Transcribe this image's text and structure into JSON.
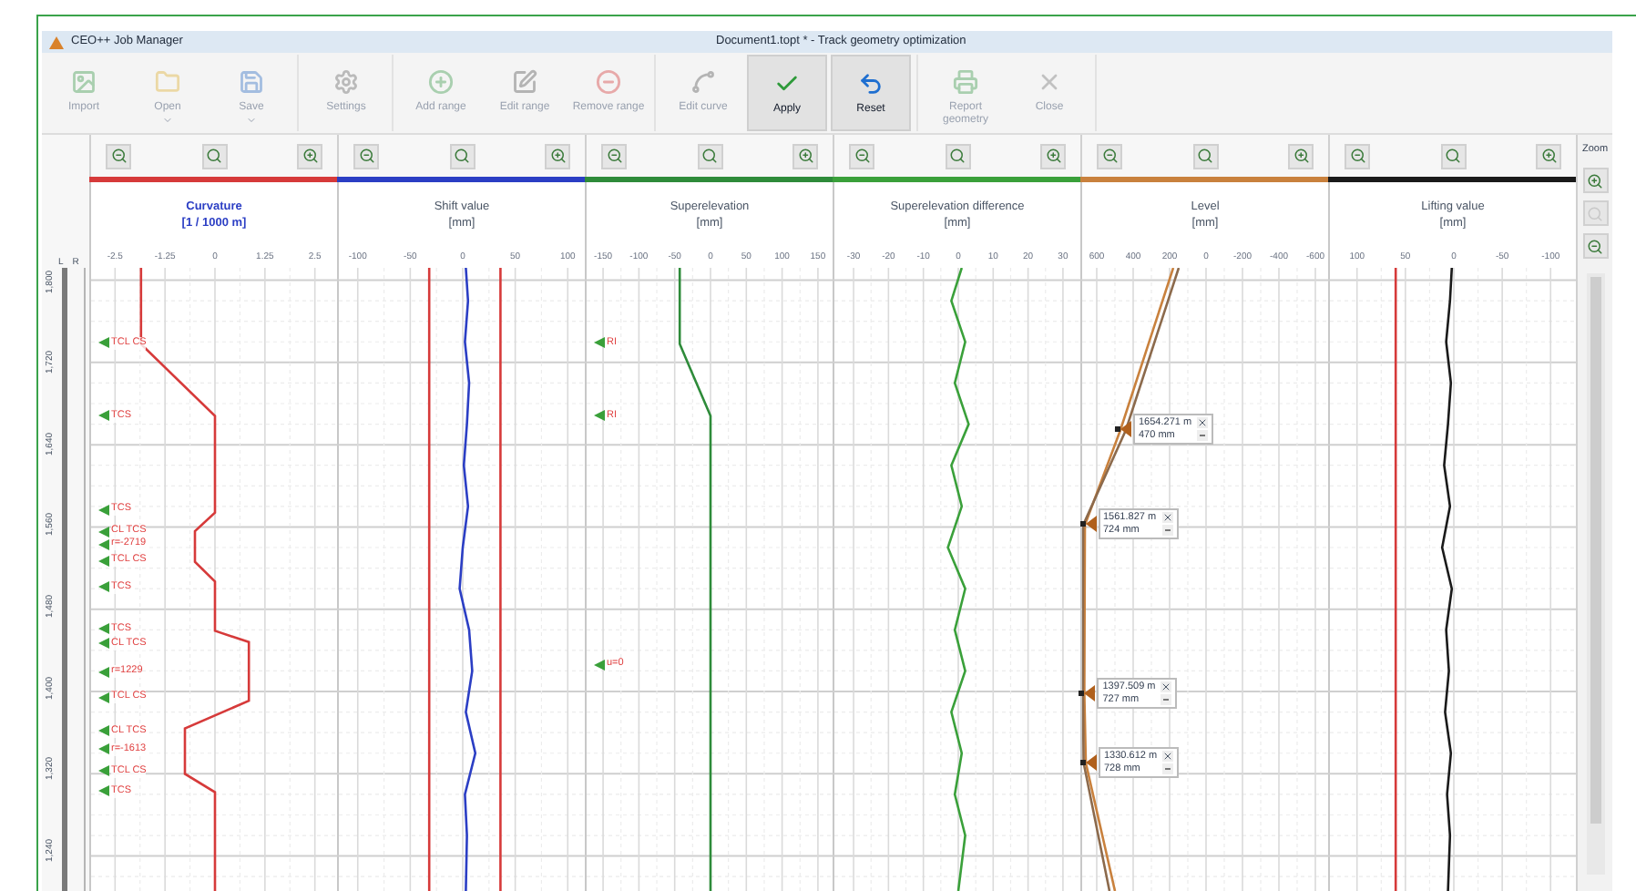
{
  "window": {
    "app_title": "CEO++ Job Manager",
    "document_title": "Document1.topt * - Track geometry optimization"
  },
  "toolbar": [
    {
      "label": "Import",
      "kind": "import",
      "disabled": true,
      "menu": false
    },
    {
      "label": "Open",
      "kind": "open",
      "disabled": true,
      "menu": true
    },
    {
      "label": "Save",
      "kind": "save",
      "disabled": true,
      "menu": true
    },
    {
      "label": "Settings",
      "kind": "settings",
      "disabled": true,
      "menu": false
    },
    {
      "label": "Add range",
      "kind": "add-range",
      "disabled": true,
      "menu": false
    },
    {
      "label": "Edit range",
      "kind": "edit-range",
      "disabled": true,
      "menu": false
    },
    {
      "label": "Remove range",
      "kind": "remove-range",
      "disabled": true,
      "menu": false
    },
    {
      "label": "Edit curve",
      "kind": "edit-curve",
      "disabled": true,
      "menu": false
    },
    {
      "label": "Apply",
      "kind": "apply",
      "disabled": false,
      "menu": false
    },
    {
      "label": "Reset",
      "kind": "reset",
      "disabled": false,
      "menu": false
    },
    {
      "label": "Report geometry",
      "kind": "report",
      "disabled": true,
      "menu": false
    },
    {
      "label": "Close",
      "kind": "close",
      "disabled": true,
      "menu": false
    }
  ],
  "axis": {
    "left_label": "L",
    "right_label": "R",
    "km_labels": [
      "1,800",
      "1,720",
      "1,640",
      "1,560",
      "1,480",
      "1,400",
      "1,320",
      "1,240"
    ]
  },
  "side_zoom": {
    "label": "Zoom",
    "buttons": [
      {
        "kind": "zoom-in",
        "disabled": false
      },
      {
        "kind": "fit",
        "disabled": true
      },
      {
        "kind": "zoom-out",
        "disabled": false
      }
    ]
  },
  "panels": [
    {
      "title": "Curvature",
      "unit": "[1 / 1000 m]",
      "color": "#d63a3a",
      "emphasized": true,
      "ticks": [
        "-2.5",
        "-1.25",
        "0",
        "1.25",
        "2.5"
      ],
      "markers": [
        "TCL CS",
        "TCS",
        "TCS",
        "CL TCS",
        "r=-2719",
        "TCL CS",
        "TCS",
        "TCS",
        "CL TCS",
        "r=1229",
        "TCL CS",
        "CL TCS",
        "r=-1613",
        "TCL CS",
        "TCS"
      ]
    },
    {
      "title": "Shift value",
      "unit": "[mm]",
      "color": "#2b3ec4",
      "emphasized": false,
      "ticks": [
        "-100",
        "-50",
        "0",
        "50",
        "100"
      ]
    },
    {
      "title": "Superelevation",
      "unit": "[mm]",
      "color": "#2e8b3a",
      "emphasized": false,
      "ticks": [
        "-150",
        "-100",
        "-50",
        "0",
        "50",
        "100",
        "150"
      ],
      "markers": [
        "RI",
        "RI",
        "u=0"
      ]
    },
    {
      "title": "Superelevation difference",
      "unit": "[mm]",
      "color": "#3aa03a",
      "emphasized": false,
      "ticks": [
        "-30",
        "-20",
        "-10",
        "0",
        "10",
        "20",
        "30"
      ]
    },
    {
      "title": "Level",
      "unit": "[mm]",
      "color": "#c9813d",
      "emphasized": false,
      "ticks": [
        "600",
        "400",
        "200",
        "0",
        "-200",
        "-400",
        "-600"
      ],
      "callouts": [
        {
          "position": "1654.271 m",
          "value": "470 mm"
        },
        {
          "position": "1561.827 m",
          "value": "724 mm"
        },
        {
          "position": "1397.509 m",
          "value": "727 mm"
        },
        {
          "position": "1330.612 m",
          "value": "728 mm"
        }
      ]
    },
    {
      "title": "Lifting value",
      "unit": "[mm]",
      "color": "#1a1a1a",
      "emphasized": false,
      "ticks": [
        "100",
        "50",
        "0",
        "-50",
        "-100"
      ]
    }
  ]
}
